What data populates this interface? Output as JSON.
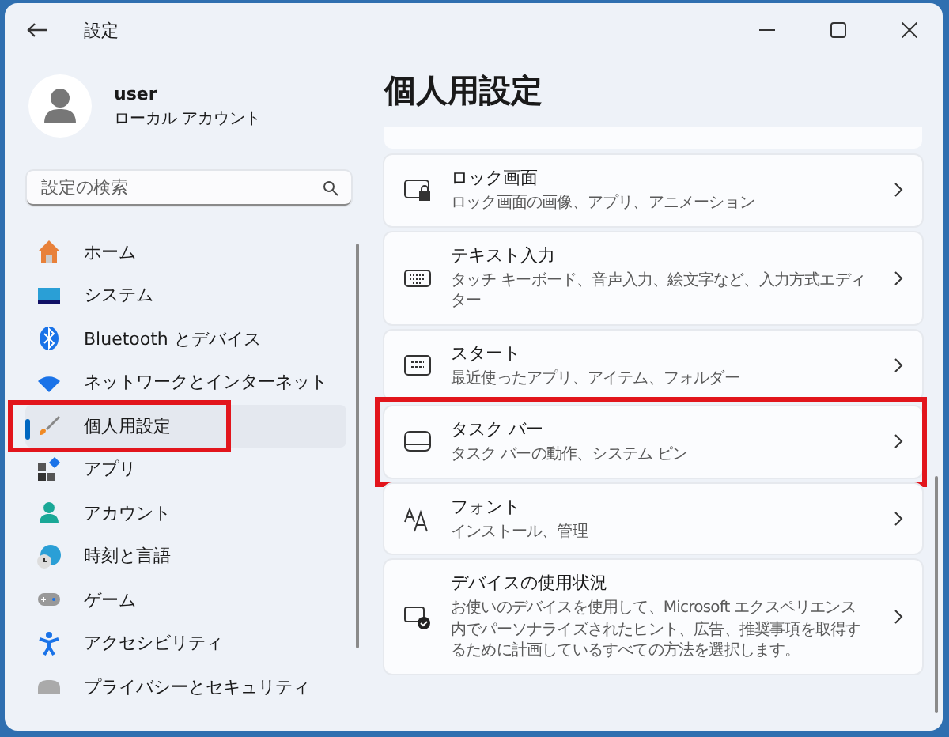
{
  "window": {
    "title": "設定"
  },
  "account": {
    "name": "user",
    "type": "ローカル アカウント"
  },
  "search": {
    "placeholder": "設定の検索"
  },
  "sidebar": {
    "items": [
      {
        "label": "ホーム",
        "selected": false,
        "highlighted": false
      },
      {
        "label": "システム",
        "selected": false,
        "highlighted": false
      },
      {
        "label": "Bluetooth とデバイス",
        "selected": false,
        "highlighted": false
      },
      {
        "label": "ネットワークとインターネット",
        "selected": false,
        "highlighted": false
      },
      {
        "label": "個人用設定",
        "selected": true,
        "highlighted": true
      },
      {
        "label": "アプリ",
        "selected": false,
        "highlighted": false
      },
      {
        "label": "アカウント",
        "selected": false,
        "highlighted": false
      },
      {
        "label": "時刻と言語",
        "selected": false,
        "highlighted": false
      },
      {
        "label": "ゲーム",
        "selected": false,
        "highlighted": false
      },
      {
        "label": "アクセシビリティ",
        "selected": false,
        "highlighted": false
      },
      {
        "label": "プライバシーとセキュリティ",
        "selected": false,
        "highlighted": false
      }
    ]
  },
  "page": {
    "title": "個人用設定",
    "cards": [
      {
        "title": "ロック画面",
        "description": "ロック画面の画像、アプリ、アニメーション",
        "highlighted": false
      },
      {
        "title": "テキスト入力",
        "description": "タッチ キーボード、音声入力、絵文字など、入力方式エディター",
        "highlighted": false
      },
      {
        "title": "スタート",
        "description": "最近使ったアプリ、アイテム、フォルダー",
        "highlighted": false
      },
      {
        "title": "タスク バー",
        "description": "タスク バーの動作、システム ピン",
        "highlighted": true
      },
      {
        "title": "フォント",
        "description": "インストール、管理",
        "highlighted": false
      },
      {
        "title": "デバイスの使用状況",
        "description": "お使いのデバイスを使用して、Microsoft エクスペリエンス内でパーソナライズされたヒント、広告、推奨事項を取得するために計画しているすべての方法を選択します。",
        "highlighted": false
      }
    ]
  }
}
